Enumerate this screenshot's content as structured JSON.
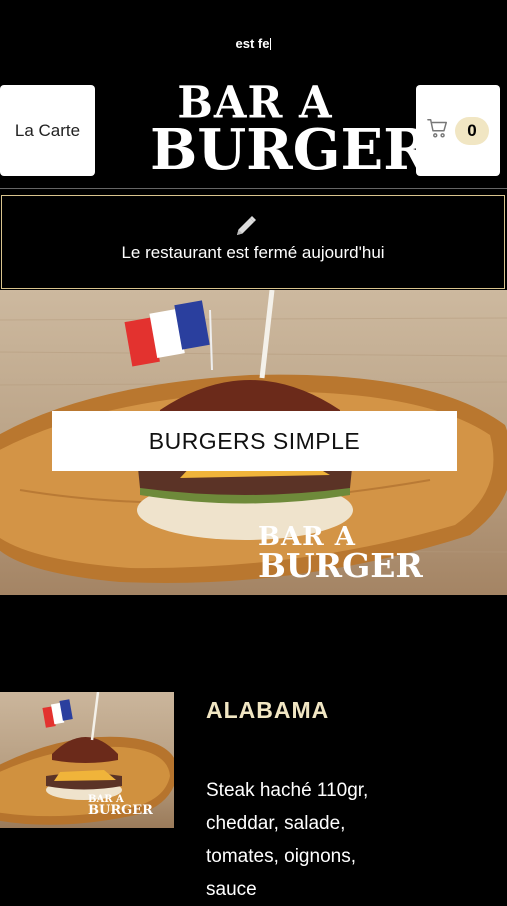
{
  "top_text": "est fe",
  "nav": {
    "menu_button_label": "La Carte",
    "cart_count": "0",
    "cart_icon": "cart-icon"
  },
  "logo": {
    "line1": "BAR A",
    "line2": "BURGER"
  },
  "notice": {
    "icon": "pencil-icon",
    "message": "Le restaurant est fermé aujourd'hui"
  },
  "hero": {
    "category_title": "BURGERS SIMPLE",
    "watermark_line1": "BAR A",
    "watermark_line2": "BURGER"
  },
  "items": [
    {
      "name": "ALABAMA",
      "description": "Steak haché 110gr, cheddar, salade, tomates, oignons, sauce",
      "watermark_line1": "BAR A",
      "watermark_line2": "BURGER"
    }
  ],
  "colors": {
    "accent": "#f1e6c3",
    "border": "#d9c48e",
    "background": "#000000"
  }
}
